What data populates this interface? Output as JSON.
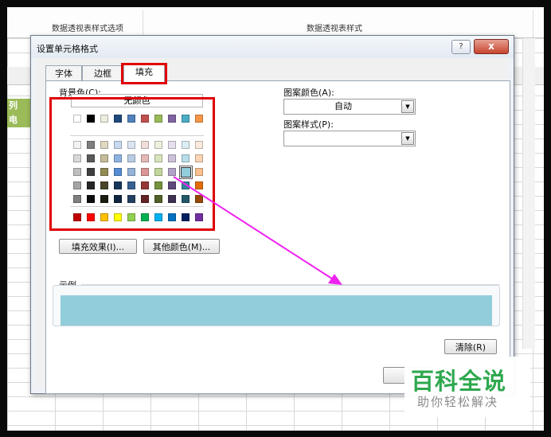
{
  "ribbon": {
    "group1": "数据透视表样式选项",
    "group2": "数据透视表样式"
  },
  "sheet": {
    "cell1": "列",
    "cell2": "电"
  },
  "dialog": {
    "title": "设置单元格格式",
    "help": "?",
    "close": "x",
    "tabs": [
      {
        "label": "字体"
      },
      {
        "label": "边框"
      },
      {
        "label": "填充"
      }
    ],
    "background_color_label": "背景色(C):",
    "no_color": "无颜色",
    "selected_color": "#92cddc",
    "palette": {
      "row_top": [
        "#ffffff",
        "#000000",
        "#eeece1",
        "#1f497d",
        "#4f81bd",
        "#c0504d",
        "#9bbb59",
        "#8064a2",
        "#4bacc6",
        "#f79646"
      ],
      "tint_rows": [
        [
          "#f2f2f2",
          "#7f7f7f",
          "#ddd9c3",
          "#c6d9f0",
          "#dbe5f1",
          "#f2dcdb",
          "#ebf1dd",
          "#e5e0ec",
          "#dbeef3",
          "#fdeada"
        ],
        [
          "#d8d8d8",
          "#595959",
          "#c4bd97",
          "#8db3e2",
          "#b8cce4",
          "#e5b9b7",
          "#d7e3bc",
          "#ccc1d9",
          "#b7dde8",
          "#fbd5b5"
        ],
        [
          "#bfbfbf",
          "#3f3f3f",
          "#938953",
          "#548dd4",
          "#95b3d7",
          "#d99694",
          "#c3d69b",
          "#b2a2c7",
          "#92cddc",
          "#fac08f"
        ],
        [
          "#a5a5a5",
          "#262626",
          "#494429",
          "#17365d",
          "#366092",
          "#953734",
          "#76923c",
          "#5f497a",
          "#31859b",
          "#e36c09"
        ],
        [
          "#7f7f7f",
          "#0c0c0c",
          "#1d1b10",
          "#0f243e",
          "#244061",
          "#632423",
          "#4f6128",
          "#3f3151",
          "#205867",
          "#974806"
        ]
      ],
      "row_standard": [
        "#c00000",
        "#ff0000",
        "#ffc000",
        "#ffff00",
        "#92d050",
        "#00b050",
        "#00b0f0",
        "#0070c0",
        "#002060",
        "#7030a0"
      ]
    },
    "fill_effects_button": "填充效果(I)...",
    "more_colors_button": "其他颜色(M)...",
    "pattern_color_label": "图案颜色(A):",
    "pattern_color_value": "自动",
    "pattern_style_label": "图案样式(P):",
    "pattern_style_value": "",
    "sample_label": "示例",
    "clear_button": "清除(R)"
  },
  "annotation": {
    "highlight_color": "#e00000",
    "arrow_color": "#ee22ee"
  },
  "watermark": {
    "title": "百科全说",
    "subtitle": "助你轻松解决"
  }
}
